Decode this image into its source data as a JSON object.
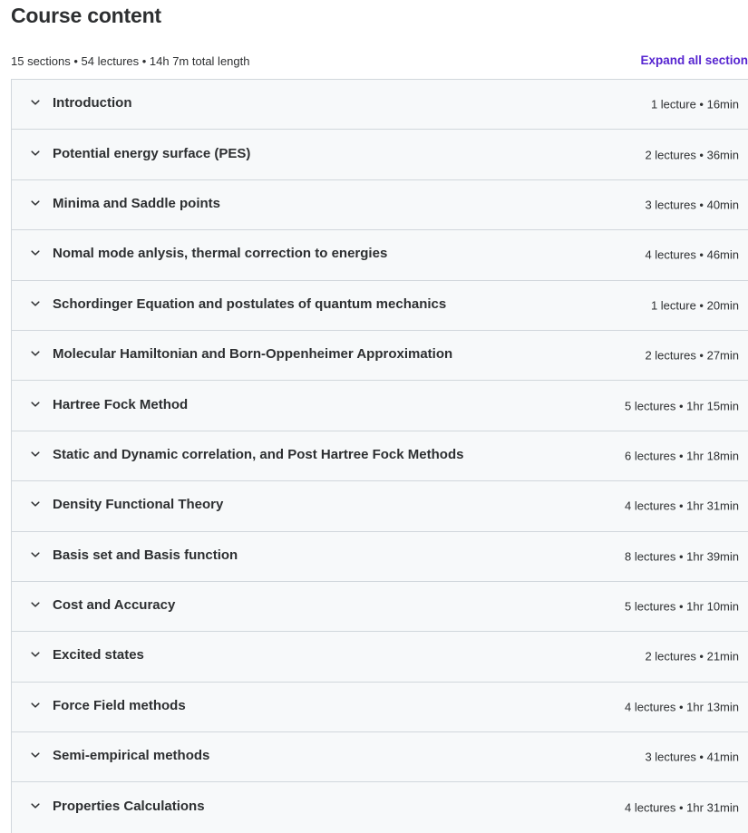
{
  "header": {
    "title": "Course content",
    "summary": "15 sections • 54 lectures • 14h 7m total length",
    "expand_all_label": "Expand all section"
  },
  "sections": [
    {
      "title": "Introduction",
      "meta": "1 lecture • 16min"
    },
    {
      "title": "Potential energy surface (PES)",
      "meta": "2 lectures • 36min"
    },
    {
      "title": "Minima and Saddle points",
      "meta": "3 lectures • 40min"
    },
    {
      "title": "Nomal mode anlysis, thermal correction to energies",
      "meta": "4 lectures • 46min"
    },
    {
      "title": "Schordinger Equation and postulates of quantum mechanics",
      "meta": "1 lecture • 20min"
    },
    {
      "title": "Molecular Hamiltonian and Born-Oppenheimer Approximation",
      "meta": "2 lectures • 27min"
    },
    {
      "title": "Hartree Fock Method",
      "meta": "5 lectures • 1hr 15min"
    },
    {
      "title": "Static and Dynamic correlation, and Post Hartree Fock Methods",
      "meta": "6 lectures • 1hr 18min"
    },
    {
      "title": "Density Functional Theory",
      "meta": "4 lectures • 1hr 31min"
    },
    {
      "title": "Basis set and Basis function",
      "meta": "8 lectures • 1hr 39min"
    },
    {
      "title": "Cost and Accuracy",
      "meta": "5 lectures • 1hr 10min"
    },
    {
      "title": "Excited states",
      "meta": "2 lectures • 21min"
    },
    {
      "title": "Force Field methods",
      "meta": "4 lectures • 1hr 13min"
    },
    {
      "title": "Semi-empirical methods",
      "meta": "3 lectures • 41min"
    },
    {
      "title": "Properties Calculations",
      "meta": "4 lectures • 1hr 31min"
    }
  ],
  "icons": {
    "section_toggle": "chevron-down-icon"
  },
  "colors": {
    "accent": "#5624d0",
    "section_bg": "#f7f9fa",
    "border": "#d1d7dc",
    "text": "#2d2f31"
  }
}
